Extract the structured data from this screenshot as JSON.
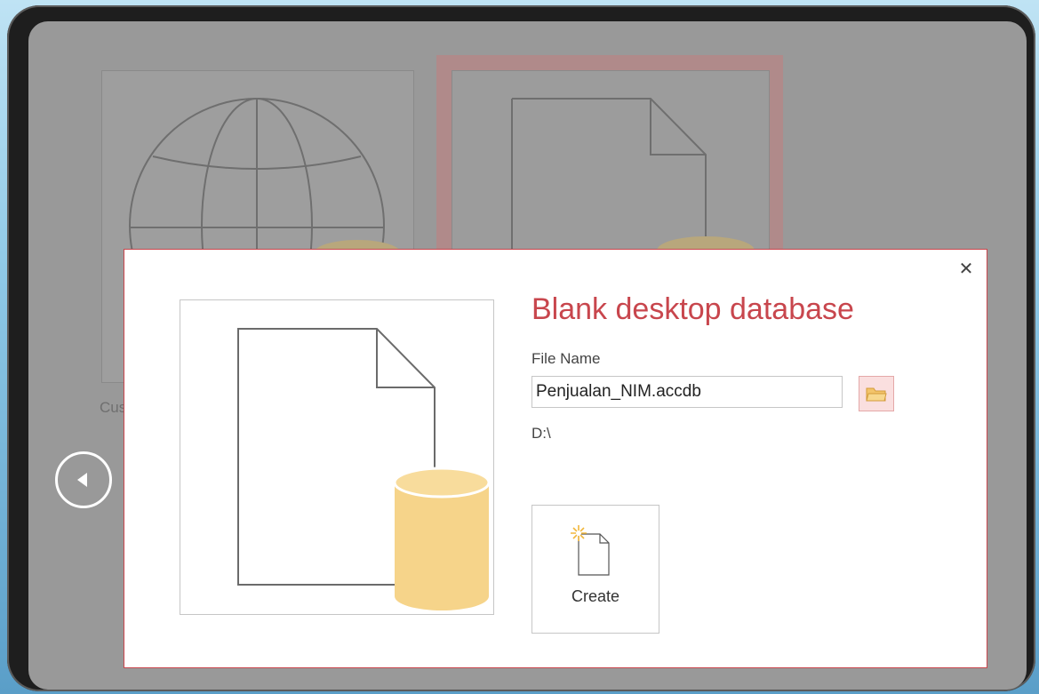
{
  "background": {
    "template_label": "Cus"
  },
  "dialog": {
    "title": "Blank desktop database",
    "file_name_label": "File Name",
    "file_name_value": "Penjualan_NIM.accdb",
    "path": "D:\\",
    "create_label": "Create",
    "close_icon": "close-icon",
    "browse_icon": "folder-icon",
    "accent_color": "#c8464d",
    "database_color": "#f6d48a"
  }
}
